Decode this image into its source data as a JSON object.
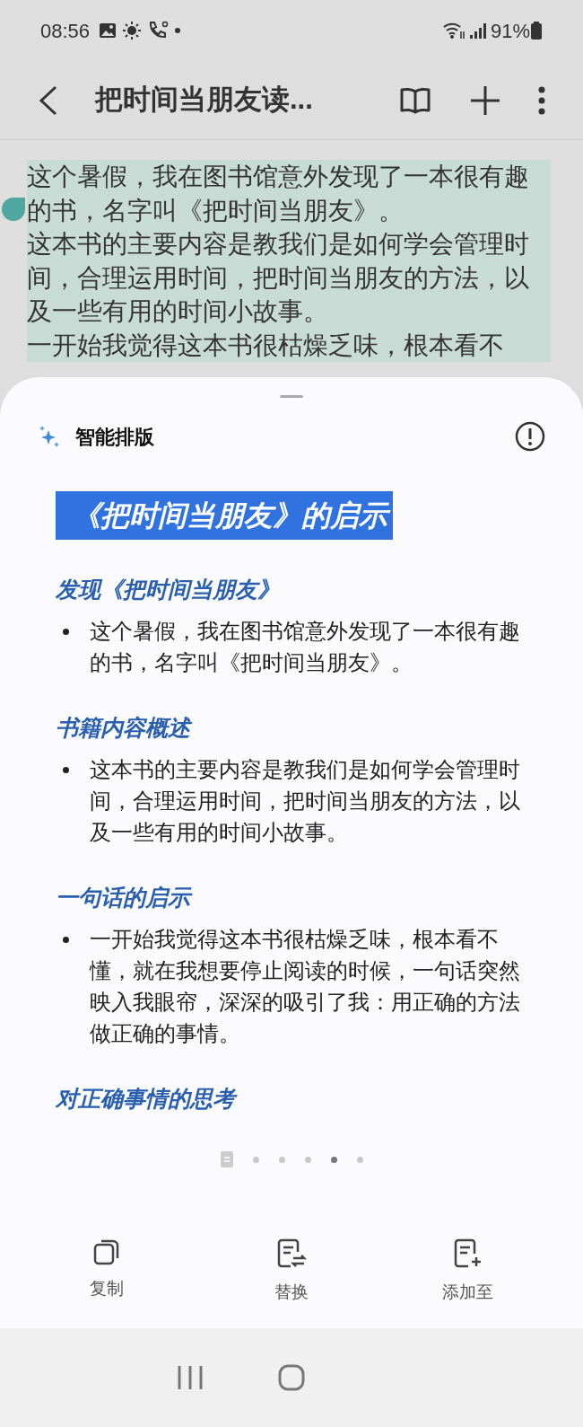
{
  "status_bar": {
    "time": "08:56",
    "battery": "91%"
  },
  "header": {
    "title": "把时间当朋友读..."
  },
  "note": {
    "paragraphs": [
      "这个暑假，我在图书馆意外发现了一本很有趣的书，名字叫《把时间当朋友》。",
      "这本书的主要内容是教我们是如何学会管理时间，合理运用时间，把时间当朋友的方法，以及一些有用的时间小故事。",
      "一开始我觉得这本书很枯燥乏味，根本看不"
    ]
  },
  "sheet": {
    "title": "智能排版",
    "doc_title": "《把时间当朋友》的启示",
    "sections": [
      {
        "heading": "发现《把时间当朋友》",
        "bullets": [
          "这个暑假，我在图书馆意外发现了一本很有趣的书，名字叫《把时间当朋友》。"
        ]
      },
      {
        "heading": "书籍内容概述",
        "bullets": [
          "这本书的主要内容是教我们是如何学会管理时间，合理运用时间，把时间当朋友的方法，以及一些有用的时间小故事。"
        ]
      },
      {
        "heading": "一句话的启示",
        "bullets": [
          "一开始我觉得这本书很枯燥乏味，根本看不懂，就在我想要停止阅读的时候，一句话突然映入我眼帘，深深的吸引了我：用正确的方法做正确的事情。"
        ]
      },
      {
        "heading": "对正确事情的思考"
      }
    ],
    "pages": [
      {
        "kind": "list",
        "selected": false
      },
      {
        "kind": "dot",
        "selected": false
      },
      {
        "kind": "dot",
        "selected": false
      },
      {
        "kind": "dot",
        "selected": false
      },
      {
        "kind": "dot",
        "selected": true
      },
      {
        "kind": "dot",
        "selected": false
      }
    ],
    "actions": [
      {
        "kind": "copy",
        "label": "复制"
      },
      {
        "kind": "replace",
        "label": "替换"
      },
      {
        "kind": "add",
        "label": "添加至"
      }
    ]
  }
}
